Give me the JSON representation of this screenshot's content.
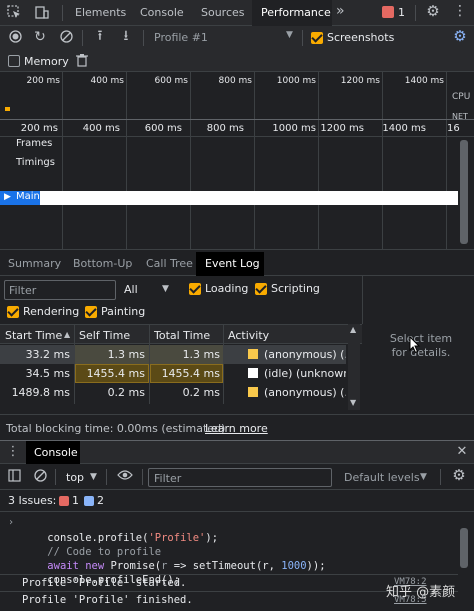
{
  "tabs": {
    "elements": "Elements",
    "console": "Console",
    "sources": "Sources",
    "performance": "Performance",
    "more": "»",
    "issues_count": "1"
  },
  "perf_toolbar": {
    "profile_select": "Profile #1",
    "screenshots": "Screenshots",
    "memory": "Memory"
  },
  "overview_ticks": [
    "200 ms",
    "400 ms",
    "600 ms",
    "800 ms",
    "1000 ms",
    "1200 ms",
    "1400 ms"
  ],
  "overview_labels": {
    "cpu": "CPU",
    "net": "NET"
  },
  "timeline_ticks": [
    "200 ms",
    "400 ms",
    "600 ms",
    "800 ms",
    "1000 ms",
    "1200 ms",
    "1400 ms",
    "16"
  ],
  "tracks": {
    "frames": "Frames",
    "timings": "Timings",
    "main": "Main"
  },
  "bottom_tabs": [
    "Summary",
    "Bottom-Up",
    "Call Tree",
    "Event Log"
  ],
  "filter_bar": {
    "filter_placeholder": "Filter",
    "all": "All",
    "loading": "Loading",
    "scripting": "Scripting",
    "rendering": "Rendering",
    "painting": "Painting"
  },
  "event_table": {
    "headers": [
      "Start Time",
      "Self Time",
      "Total Time",
      "Activity"
    ],
    "rows": [
      {
        "start": "33.2 ms",
        "self": "1.3 ms",
        "total": "1.3 ms",
        "activity": "(anonymous) (...",
        "color": "#f9c94c"
      },
      {
        "start": "34.5 ms",
        "self": "1455.4 ms",
        "total": "1455.4 ms",
        "activity": "(idle) (unknown)",
        "color": "#ffffff"
      },
      {
        "start": "1489.8 ms",
        "self": "0.2 ms",
        "total": "0.2 ms",
        "activity": "(anonymous) (...",
        "color": "#f9c94c"
      }
    ],
    "detail_hint": "Select item for details."
  },
  "status": {
    "blocking": "Total blocking time: 0.00ms (estimated)",
    "learn_more": "Learn more"
  },
  "drawer": {
    "tab": "Console",
    "context": "top",
    "filter_placeholder": "Filter",
    "levels": "Default levels",
    "issues_label": "3 Issues:",
    "issues_errors": "1",
    "issues_info": "2"
  },
  "console_lines": {
    "l1_a": "console.",
    "l1_b": "profile",
    "l1_c": "(",
    "l1_d": "'Profile'",
    "l1_e": ");",
    "l2": "// Code to profile",
    "l3_await": "await",
    "l3_new": "new",
    "l3_promise": "Promise(",
    "l3_r": "r",
    "l3_arrow": " => setTimeout(",
    "l3_r2": "r",
    "l3_comma": ", ",
    "l3_num": "1000",
    "l3_end": "));",
    "l4_a": "console.",
    "l4_b": "profileEnd",
    "l4_c": "();",
    "out1": "Profile 'Profile' started.",
    "out2": "Profile 'Profile' finished.",
    "src1": "VM78:2",
    "src2": "VM78:5"
  },
  "watermark": "知乎 @素颜"
}
